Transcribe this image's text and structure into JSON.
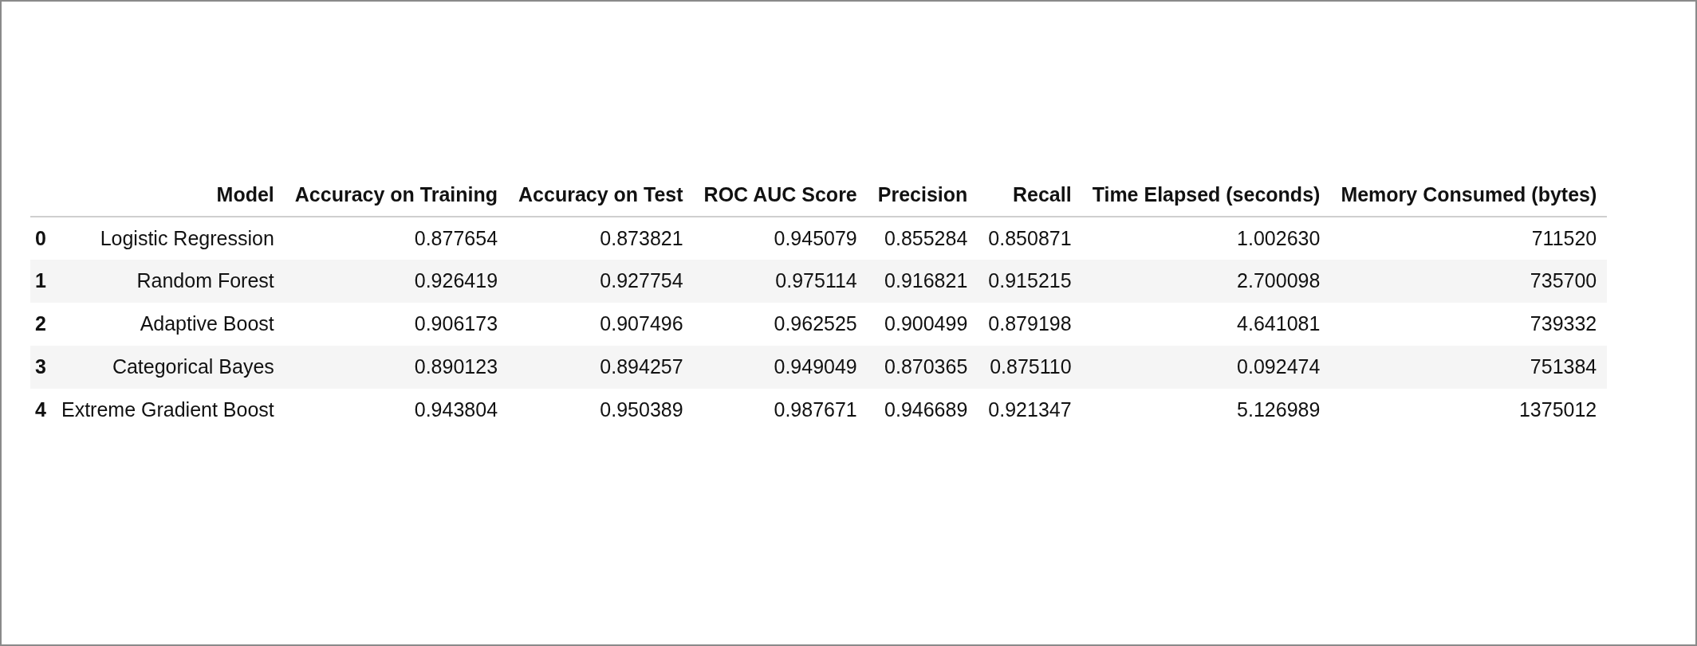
{
  "table": {
    "columns": [
      "",
      "Model",
      "Accuracy on Training",
      "Accuracy on Test",
      "ROC AUC Score",
      "Precision",
      "Recall",
      "Time Elapsed (seconds)",
      "Memory Consumed (bytes)"
    ],
    "rows": [
      [
        "0",
        "Logistic Regression",
        "0.877654",
        "0.873821",
        "0.945079",
        "0.855284",
        "0.850871",
        "1.002630",
        "711520"
      ],
      [
        "1",
        "Random Forest",
        "0.926419",
        "0.927754",
        "0.975114",
        "0.916821",
        "0.915215",
        "2.700098",
        "735700"
      ],
      [
        "2",
        "Adaptive Boost",
        "0.906173",
        "0.907496",
        "0.962525",
        "0.900499",
        "0.879198",
        "4.641081",
        "739332"
      ],
      [
        "3",
        "Categorical Bayes",
        "0.890123",
        "0.894257",
        "0.949049",
        "0.870365",
        "0.875110",
        "0.092474",
        "751384"
      ],
      [
        "4",
        "Extreme Gradient Boost",
        "0.943804",
        "0.950389",
        "0.987671",
        "0.946689",
        "0.921347",
        "5.126989",
        "1375012"
      ]
    ]
  }
}
